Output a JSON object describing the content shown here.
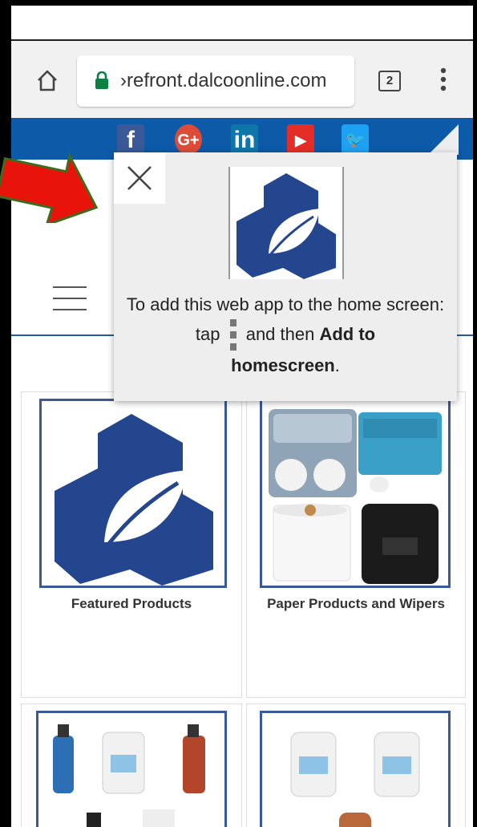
{
  "browser": {
    "url": "›refront.dalcoonline.com",
    "tab_count": "2",
    "icons": [
      "home-icon",
      "lock-icon",
      "tab-switcher-icon",
      "overflow-menu-icon"
    ]
  },
  "social": {
    "facebook": "f",
    "googleplus": "G+",
    "linkedin": "in",
    "youtube": "▶",
    "twitter": "🐦"
  },
  "popup": {
    "text_before": "To add this web app to the home screen: tap",
    "text_middle": "and then",
    "text_bold1": "Add to",
    "text_bold2": "homescreen",
    "text_end": "."
  },
  "products": [
    {
      "label": "Featured Products"
    },
    {
      "label": "Paper Products and Wipers"
    },
    {
      "label": ""
    },
    {
      "label": ""
    }
  ],
  "colors": {
    "brand_blue": "#24468e",
    "social_bar": "#0c5aa8",
    "arrow_red": "#e8140c",
    "arrow_outline": "#3f6b1c"
  }
}
